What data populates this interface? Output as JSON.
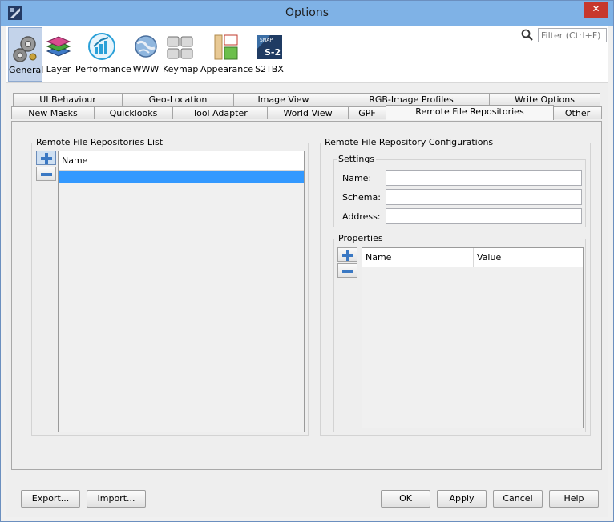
{
  "window": {
    "title": "Options",
    "close_glyph": "✕"
  },
  "toolbar": {
    "categories": [
      {
        "label": "General",
        "icon": "gears-icon",
        "selected": true
      },
      {
        "label": "Layer",
        "icon": "layers-icon"
      },
      {
        "label": "Performance",
        "icon": "performance-icon"
      },
      {
        "label": "WWW",
        "icon": "globe-icon"
      },
      {
        "label": "Keymap",
        "icon": "keyboard-icon"
      },
      {
        "label": "Appearance",
        "icon": "appearance-icon"
      },
      {
        "label": "S2TBX",
        "icon": "s2tbx-icon",
        "icon_text": "S-2",
        "icon_small_text": "SNAP"
      }
    ],
    "filter": {
      "placeholder": "Filter (Ctrl+F)"
    }
  },
  "tabs": {
    "row_top": [
      "UI Behaviour",
      "Geo-Location",
      "Image View",
      "RGB-Image Profiles",
      "Write Options"
    ],
    "row_bottom": [
      "New Masks",
      "Quicklooks",
      "Tool Adapter",
      "World View",
      "GPF",
      "Remote File Repositories",
      "Other"
    ],
    "active": "Remote File Repositories"
  },
  "repos_list": {
    "title": "Remote File Repositories List",
    "column": "Name"
  },
  "repo_config": {
    "title": "Remote File Repository Configurations",
    "settings": {
      "title": "Settings",
      "name_label": "Name:",
      "schema_label": "Schema:",
      "address_label": "Address:",
      "name_value": "",
      "schema_value": "",
      "address_value": ""
    },
    "properties": {
      "title": "Properties",
      "col_name": "Name",
      "col_value": "Value"
    }
  },
  "buttons": {
    "export": "Export...",
    "import": "Import...",
    "ok": "OK",
    "apply": "Apply",
    "cancel": "Cancel",
    "help": "Help"
  },
  "colors": {
    "selection": "#3399ff",
    "titlebar": "#7fb2e6",
    "close": "#c7382d"
  }
}
